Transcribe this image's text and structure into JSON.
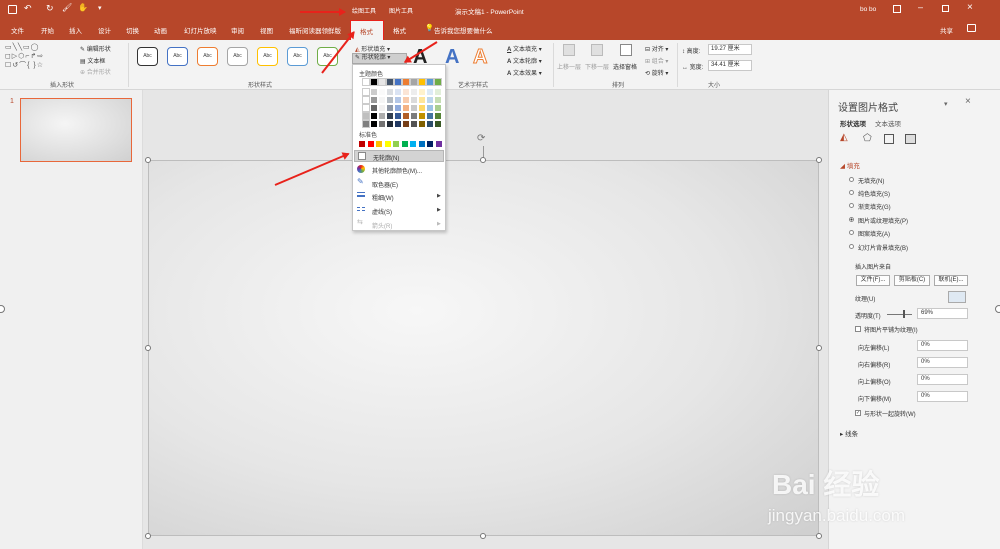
{
  "titlebar": {
    "quick_access_icons": [
      "save-icon",
      "undo-icon",
      "redo-icon",
      "format-painter-icon",
      "touch-mode-icon",
      "customize-icon"
    ],
    "context_tools": [
      "绘图工具",
      "图片工具"
    ],
    "title": "演示文稿1 - PowerPoint",
    "user": "bo bo"
  },
  "tabs": [
    "文件",
    "开始",
    "插入",
    "设计",
    "切换",
    "动画",
    "幻灯片放映",
    "审阅",
    "视图",
    "福昕阅读器领鲜版",
    "格式",
    "格式"
  ],
  "tell_me": "告诉我您想要做什么",
  "share": "共享",
  "ribbon": {
    "insert_shapes": {
      "label": "插入形状",
      "edit_shape": "编辑形状",
      "textbox": "文本框",
      "merge_shapes": "合并形状"
    },
    "shape_styles": {
      "label": "形状样式",
      "sample": "Abc",
      "shape_fill": "形状填充",
      "shape_outline": "形状轮廓"
    },
    "wordart": {
      "label": "艺术字样式",
      "sample": "A",
      "text_fill": "文本填充",
      "text_outline": "文本轮廓",
      "text_effects": "文本效果"
    },
    "arrange": {
      "label": "排列",
      "bring_forward": "上移一层",
      "send_backward": "下移一层",
      "selection_pane": "选择窗格",
      "align": "对齐",
      "group": "组合",
      "rotate": "旋转"
    },
    "size": {
      "label": "大小",
      "height_label": "高度:",
      "height": "19.27 厘米",
      "width_label": "宽度:",
      "width": "34.41 厘米"
    }
  },
  "outline_dropdown": {
    "theme_colors_label": "主题颜色",
    "standard_colors_label": "标准色",
    "no_outline": "无轮廓(N)",
    "more_colors": "其他轮廓颜色(M)...",
    "eyedropper": "取色器(E)",
    "weight": "粗细(W)",
    "dashes": "虚线(S)",
    "arrows": "箭头(R)",
    "theme_top_row": [
      "#ffffff",
      "#000000",
      "#e7e6e6",
      "#44546a",
      "#4472c4",
      "#ed7d31",
      "#a5a5a5",
      "#ffc000",
      "#5b9bd5",
      "#70ad47"
    ],
    "standard_colors": [
      "#c00000",
      "#ff0000",
      "#ffc000",
      "#ffff00",
      "#92d050",
      "#00b050",
      "#00b0f0",
      "#0070c0",
      "#002060",
      "#7030a0"
    ]
  },
  "slides": [
    {
      "number": "1"
    }
  ],
  "format_pane": {
    "title": "设置图片格式",
    "tab_shape": "形状选项",
    "tab_text": "文本选项",
    "fill_header": "填充",
    "fill_options": [
      "无填充(N)",
      "纯色填充(S)",
      "渐变填充(G)",
      "图片或纹理填充(P)",
      "图案填充(A)",
      "幻灯片背景填充(B)"
    ],
    "selected_fill": "图片或纹理填充(P)",
    "insert_picture_from": "插入图片来自",
    "file_btn": "文件(F)...",
    "clipboard_btn": "剪贴板(C)",
    "online_btn": "联机(E)...",
    "texture_label": "纹理(U)",
    "transparency_label": "透明度(T)",
    "transparency": "69%",
    "tile_label": "将图片平铺为纹理(I)",
    "offset_left_label": "向左偏移(L)",
    "offset_left": "0%",
    "offset_right_label": "向右偏移(R)",
    "offset_right": "0%",
    "offset_top_label": "向上偏移(O)",
    "offset_top": "0%",
    "offset_bottom_label": "向下偏移(M)",
    "offset_bottom": "0%",
    "rotate_with_shape": "与形状一起旋转(W)",
    "line_header": "线条"
  },
  "watermark": {
    "brand": "Bai 经验",
    "url": "jingyan.baidu.com"
  }
}
